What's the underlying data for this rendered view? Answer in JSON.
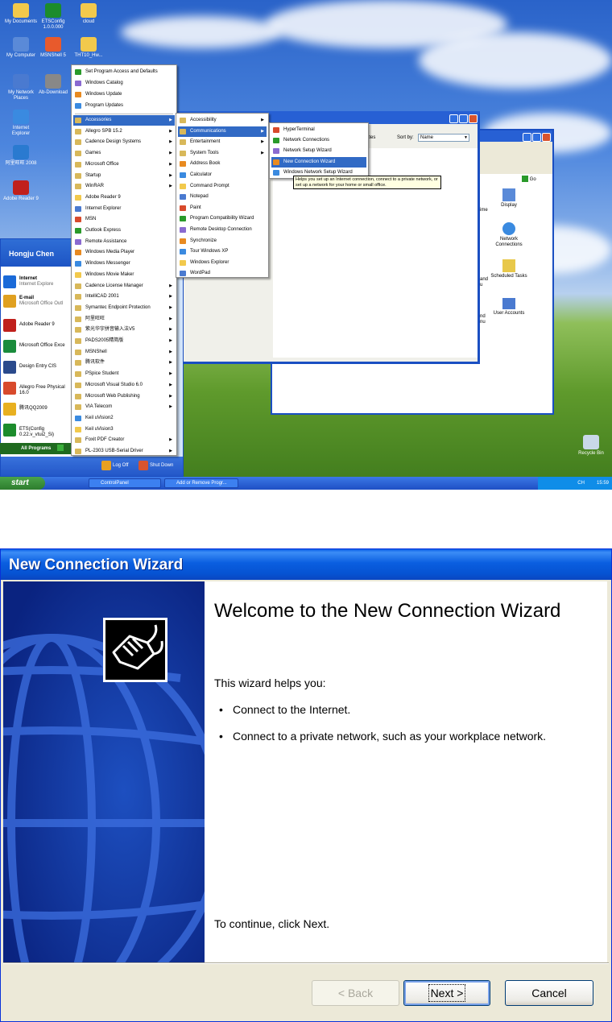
{
  "desktop": {
    "icons": [
      {
        "label": "My Documents",
        "color": "#f2c94c"
      },
      {
        "label": "ETSConfig 1.0.0.000",
        "color": "#1c8c2c"
      },
      {
        "label": "cloud",
        "color": "#f2c94c"
      },
      {
        "label": "My Computer",
        "color": "#5a8ad8"
      },
      {
        "label": "MSNShell 5",
        "color": "#e85a2c"
      },
      {
        "label": "THT10_Hw...",
        "color": "#f2c94c"
      },
      {
        "label": "My Network Places",
        "color": "#4a7ad0"
      },
      {
        "label": "Ab-Download",
        "color": "#888888"
      },
      {
        "label": "Internet Explorer",
        "color": "#3a8ae0"
      },
      {
        "label": "阿里旺旺 2008",
        "color": "#2a7ad0"
      },
      {
        "label": "Adobe Reader 9",
        "color": "#c0201c"
      }
    ],
    "recycle_bin": "Recycle Bin"
  },
  "taskbar": {
    "start_label": "start",
    "buttons": [
      "ControlPanel",
      "Add or Remove Progr..."
    ],
    "tray_text": "CH",
    "clock": "15:59"
  },
  "start_menu": {
    "user": "Hongju Chen",
    "pinned": [
      {
        "title": "Internet",
        "subtitle": "Internet Explore",
        "color": "#1a6ad8"
      },
      {
        "title": "E-mail",
        "subtitle": "Microsoft Office Outl",
        "color": "#e0a020"
      }
    ],
    "recent": [
      {
        "label": "Adobe Reader 9",
        "color": "#c0201c"
      },
      {
        "label": "Microsoft Office Exce",
        "color": "#1a8c3c"
      },
      {
        "label": "Design Entry CIS",
        "color": "#2a4a8c"
      },
      {
        "label": "Allegro Free Physical 16.0",
        "color": "#d84a2c"
      },
      {
        "label": "腾讯QQ2009",
        "color": "#e8b020"
      },
      {
        "label": "ETS(Config 0.22.v_vtui2_Si)",
        "color": "#1c8c2c"
      }
    ],
    "all_programs": "All Programs",
    "log_off": "Log Off",
    "shut_down": "Shut Down"
  },
  "programs_menu": {
    "top_items": [
      "Set Program Access and Defaults",
      "Windows Catalog",
      "Windows Update",
      "Program Updates"
    ],
    "items": [
      {
        "label": "Accessories",
        "sub": true,
        "selected": true
      },
      {
        "label": "Allegro SPB 15.2",
        "sub": true
      },
      {
        "label": "Cadence Design Systems",
        "sub": true
      },
      {
        "label": "Games",
        "sub": true
      },
      {
        "label": "Microsoft Office",
        "sub": true
      },
      {
        "label": "Startup",
        "sub": true
      },
      {
        "label": "WinRAR",
        "sub": true
      },
      {
        "label": "Adobe Reader 9",
        "sub": false
      },
      {
        "label": "Internet Explorer",
        "sub": false
      },
      {
        "label": "MSN",
        "sub": false
      },
      {
        "label": "Outlook Express",
        "sub": false
      },
      {
        "label": "Remote Assistance",
        "sub": false
      },
      {
        "label": "Windows Media Player",
        "sub": false
      },
      {
        "label": "Windows Messenger",
        "sub": false
      },
      {
        "label": "Windows Movie Maker",
        "sub": false
      },
      {
        "label": "Cadence License Manager",
        "sub": true
      },
      {
        "label": "IntelliCAD 2001",
        "sub": true
      },
      {
        "label": "Symantec Endpoint Protection",
        "sub": true
      },
      {
        "label": "阿里旺旺",
        "sub": true
      },
      {
        "label": "紫光华宇拼音输入法V5",
        "sub": true
      },
      {
        "label": "PADS2005精简版",
        "sub": true
      },
      {
        "label": "MSNShell",
        "sub": true
      },
      {
        "label": "腾讯软件",
        "sub": true
      },
      {
        "label": "PSpice Student",
        "sub": true
      },
      {
        "label": "Microsoft Visual Studio 6.0",
        "sub": true
      },
      {
        "label": "Microsoft Web Publishing",
        "sub": true
      },
      {
        "label": "VIA Telecom",
        "sub": true
      },
      {
        "label": "Keil uVision2",
        "sub": false
      },
      {
        "label": "Keil uVision3",
        "sub": false
      },
      {
        "label": "Foxit PDF Creator",
        "sub": true
      },
      {
        "label": "PL-2303 USB-Serial Driver",
        "sub": true
      }
    ]
  },
  "accessories_menu": {
    "items": [
      {
        "label": "Accessibility",
        "sub": true
      },
      {
        "label": "Communications",
        "sub": true,
        "selected": true
      },
      {
        "label": "Entertainment",
        "sub": true
      },
      {
        "label": "System Tools",
        "sub": true
      },
      {
        "label": "Address Book",
        "sub": false
      },
      {
        "label": "Calculator",
        "sub": false
      },
      {
        "label": "Command Prompt",
        "sub": false
      },
      {
        "label": "Notepad",
        "sub": false
      },
      {
        "label": "Paint",
        "sub": false
      },
      {
        "label": "Program Compatibility Wizard",
        "sub": false
      },
      {
        "label": "Remote Desktop Connection",
        "sub": false
      },
      {
        "label": "Synchronize",
        "sub": false
      },
      {
        "label": "Tour Windows XP",
        "sub": false
      },
      {
        "label": "Windows Explorer",
        "sub": false
      },
      {
        "label": "WordPad",
        "sub": false
      }
    ]
  },
  "communications_menu": {
    "items": [
      {
        "label": "HyperTerminal",
        "selected": false
      },
      {
        "label": "Network Connections",
        "selected": false
      },
      {
        "label": "Network Setup Wizard",
        "selected": false
      },
      {
        "label": "New Connection Wizard",
        "selected": true
      },
      {
        "label": "Windows Network Setup Wizard",
        "selected": false
      }
    ]
  },
  "tooltip": "Helps you set up an Internet connection, connect to a private network, or set up a network for your home or small office.",
  "add_remove_window": {
    "updates_text": "ates",
    "sort_by_label": "Sort by:",
    "sort_by_value": "Name"
  },
  "control_panel": {
    "go_label": "Go",
    "items": [
      {
        "label": "Display"
      },
      {
        "label": "Network Connections"
      },
      {
        "label": "Scheduled Tasks"
      },
      {
        "label": "User Accounts"
      }
    ],
    "partial_labels": [
      "ime",
      "and\nu",
      "nd\nnu"
    ]
  },
  "wizard": {
    "title": "New Connection Wizard",
    "heading": "Welcome to the New Connection Wizard",
    "intro": "This wizard helps you:",
    "bullets": [
      "Connect to the Internet.",
      "Connect to a private network, such as your workplace network."
    ],
    "continue_text": "To continue, click Next.",
    "buttons": {
      "back": "< Back",
      "next": "Next >",
      "cancel": "Cancel"
    }
  }
}
